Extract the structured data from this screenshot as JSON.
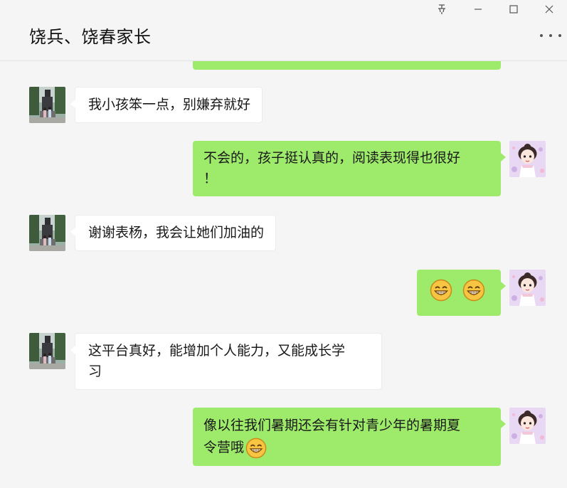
{
  "window": {
    "title": "饶兵、饶春家长",
    "controls": {
      "pin": "pin-icon",
      "minimize": "minimize-icon",
      "maximize": "maximize-icon",
      "close": "close-icon"
    }
  },
  "colors": {
    "outgoing_bubble": "#9eea6a",
    "incoming_bubble": "#ffffff",
    "background": "#f5f5f5"
  },
  "messages": [
    {
      "side": "left",
      "text": "我小孩笨一点，别嫌弃就好",
      "avatar": "statue-photo-avatar"
    },
    {
      "side": "right",
      "line1": "不会的，孩子挺认真的，阅读表现得也很好",
      "line2": "！",
      "avatar": "cartoon-girl-avatar"
    },
    {
      "side": "left",
      "text": "谢谢表杨，我会让她们加油的",
      "avatar": "statue-photo-avatar"
    },
    {
      "side": "right",
      "emojis": [
        "grin-emoji",
        "grin-emoji"
      ],
      "avatar": "cartoon-girl-avatar"
    },
    {
      "side": "left",
      "line1": "这平台真好，能增加个人能力，又能成长学",
      "line2": "习",
      "avatar": "statue-photo-avatar"
    },
    {
      "side": "right",
      "line1": "像以往我们暑期还会有针对青少年的暑期夏",
      "line2": "令营哦",
      "emoji": "grin-emoji",
      "avatar": "cartoon-girl-avatar"
    }
  ]
}
